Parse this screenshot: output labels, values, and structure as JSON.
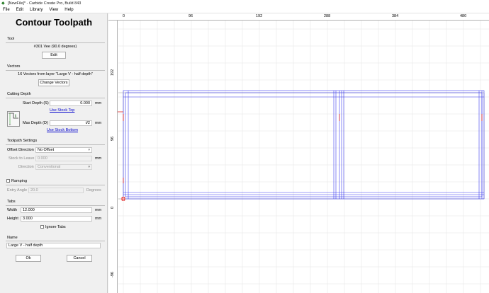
{
  "window": {
    "title": "[NewFile]* - Carbide Create Pro, Build 843"
  },
  "menu": [
    "File",
    "Edit",
    "Library",
    "View",
    "Help"
  ],
  "panel": {
    "heading": "Contour Toolpath",
    "tool": {
      "title": "Tool",
      "name": "#301 Vee (90.0 degrees)",
      "edit_label": "Edit"
    },
    "vectors": {
      "title": "Vectors",
      "summary": "16 Vectors from layer \"Large V - half depth\"",
      "change_label": "Change Vectors"
    },
    "cutting_depth": {
      "title": "Cutting Depth",
      "start_label": "Start Depth (S)",
      "start_value": "0.000",
      "start_unit": "mm",
      "use_stock_top": "Use Stock Top",
      "max_label": "Max Depth (D)",
      "max_value": "t/2",
      "max_unit": "mm",
      "use_stock_bottom": "Use Stock Bottom"
    },
    "toolpath_settings": {
      "title": "Toolpath Settings",
      "offset_label": "Offset Direction",
      "offset_value": "No Offset",
      "stock_label": "Stock to Leave",
      "stock_value": "0.000",
      "stock_unit": "mm",
      "direction_label": "Direction",
      "direction_value": "Conventional"
    },
    "ramping": {
      "label": "Ramping",
      "angle_label": "Entry Angle",
      "angle_value": "20.0",
      "angle_unit": "Degrees"
    },
    "tabs": {
      "title": "Tabs",
      "width_label": "Width",
      "width_value": "12.000",
      "width_unit": "mm",
      "height_label": "Height",
      "height_value": "3.000",
      "height_unit": "mm",
      "ignore_label": "Ignore Tabs"
    },
    "name": {
      "title": "Name",
      "value": "Large V - half depth"
    },
    "ok_label": "Ok",
    "cancel_label": "Cancel"
  },
  "canvas": {
    "ruler_top": [
      "0",
      "96",
      "192",
      "288",
      "384",
      "480"
    ],
    "ruler_left": [
      "192",
      "96",
      "0",
      "-96"
    ],
    "colors": {
      "grid": "#e3e3e3",
      "vector": "#3a3af0",
      "origin": "#e02020",
      "stock_edge": "#888888"
    }
  }
}
